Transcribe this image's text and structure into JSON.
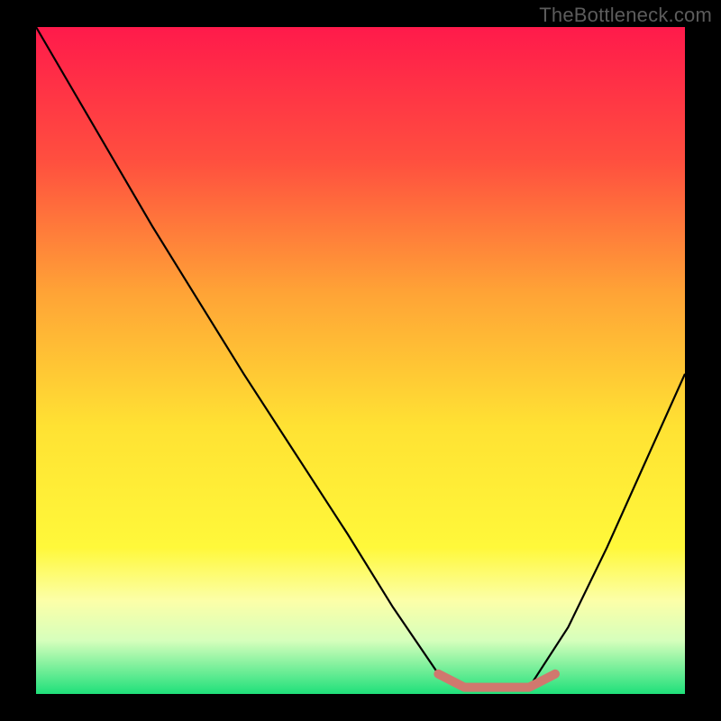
{
  "watermark": "TheBottleneck.com",
  "chart_data": {
    "type": "line",
    "title": "",
    "xlabel": "",
    "ylabel": "",
    "xlim": [
      0,
      100
    ],
    "ylim": [
      0,
      100
    ],
    "grid": false,
    "legend": false,
    "background_gradient": {
      "direction": "vertical",
      "stops": [
        {
          "pos": 0.0,
          "color": "#ff1a4b"
        },
        {
          "pos": 0.2,
          "color": "#ff4f3f"
        },
        {
          "pos": 0.4,
          "color": "#ffa436"
        },
        {
          "pos": 0.6,
          "color": "#ffe233"
        },
        {
          "pos": 0.78,
          "color": "#fff83a"
        },
        {
          "pos": 0.86,
          "color": "#fcffa8"
        },
        {
          "pos": 0.92,
          "color": "#d6ffbc"
        },
        {
          "pos": 1.0,
          "color": "#1fe07a"
        }
      ]
    },
    "series": [
      {
        "name": "bottleneck-curve",
        "color": "#000000",
        "x": [
          0,
          6,
          12,
          18,
          25,
          32,
          40,
          48,
          55,
          62,
          66,
          70,
          76,
          82,
          88,
          94,
          100
        ],
        "y": [
          100,
          90,
          80,
          70,
          59,
          48,
          36,
          24,
          13,
          3,
          1,
          1,
          1,
          10,
          22,
          35,
          48
        ]
      }
    ],
    "highlight_segment": {
      "name": "optimal-range",
      "color": "#d0786e",
      "x": [
        62,
        66,
        70,
        76,
        80
      ],
      "y": [
        3,
        1,
        1,
        1,
        3
      ]
    }
  }
}
